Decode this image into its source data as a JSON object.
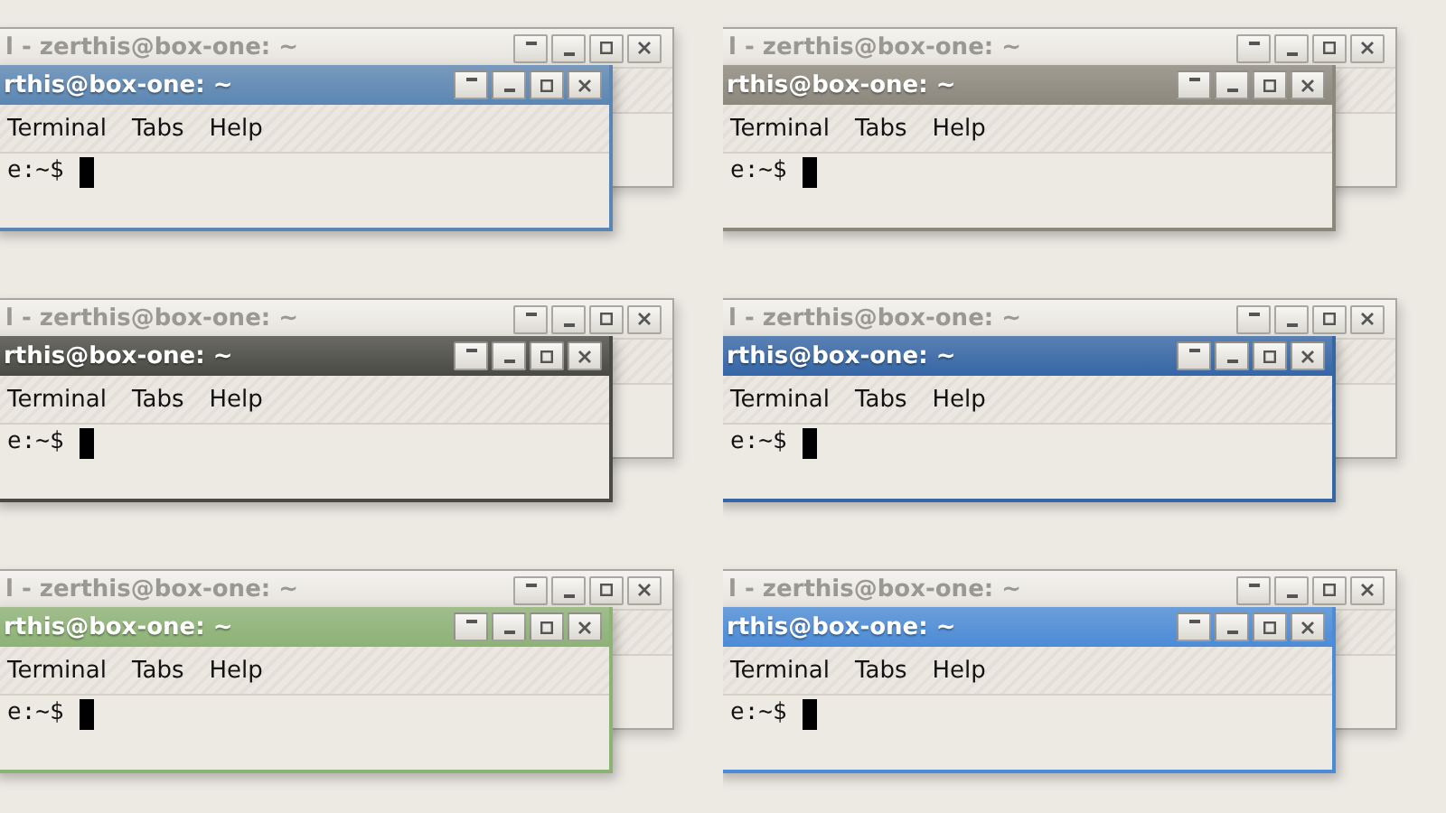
{
  "themes": [
    {
      "color": "#5b86b3",
      "back_window": {
        "title": "l - zerthis@box-one: ~"
      },
      "front_window": {
        "title": "rthis@box-one: ~",
        "menu": [
          "Terminal",
          "Tabs",
          "Help"
        ],
        "prompt": "e:~$"
      }
    },
    {
      "color": "#8d887e",
      "back_window": {
        "title": "l - zerthis@box-one: ~"
      },
      "front_window": {
        "title": "rthis@box-one: ~",
        "menu": [
          "Terminal",
          "Tabs",
          "Help"
        ],
        "prompt": "e:~$"
      }
    },
    {
      "color": "#4a4a44",
      "back_window": {
        "title": "l - zerthis@box-one: ~"
      },
      "front_window": {
        "title": "rthis@box-one: ~",
        "menu": [
          "Terminal",
          "Tabs",
          "Help"
        ],
        "prompt": "e:~$"
      }
    },
    {
      "color": "#3566a6",
      "back_window": {
        "title": "l - zerthis@box-one: ~"
      },
      "front_window": {
        "title": "rthis@box-one: ~",
        "menu": [
          "Terminal",
          "Tabs",
          "Help"
        ],
        "prompt": "e:~$"
      }
    },
    {
      "color": "#8db276",
      "back_window": {
        "title": "l - zerthis@box-one: ~"
      },
      "front_window": {
        "title": "rthis@box-one: ~",
        "menu": [
          "Terminal",
          "Tabs",
          "Help"
        ],
        "prompt": "e:~$"
      }
    },
    {
      "color": "#4b8bd7",
      "back_window": {
        "title": "l - zerthis@box-one: ~"
      },
      "front_window": {
        "title": "rthis@box-one: ~",
        "menu": [
          "Terminal",
          "Tabs",
          "Help"
        ],
        "prompt": "e:~$"
      }
    }
  ]
}
